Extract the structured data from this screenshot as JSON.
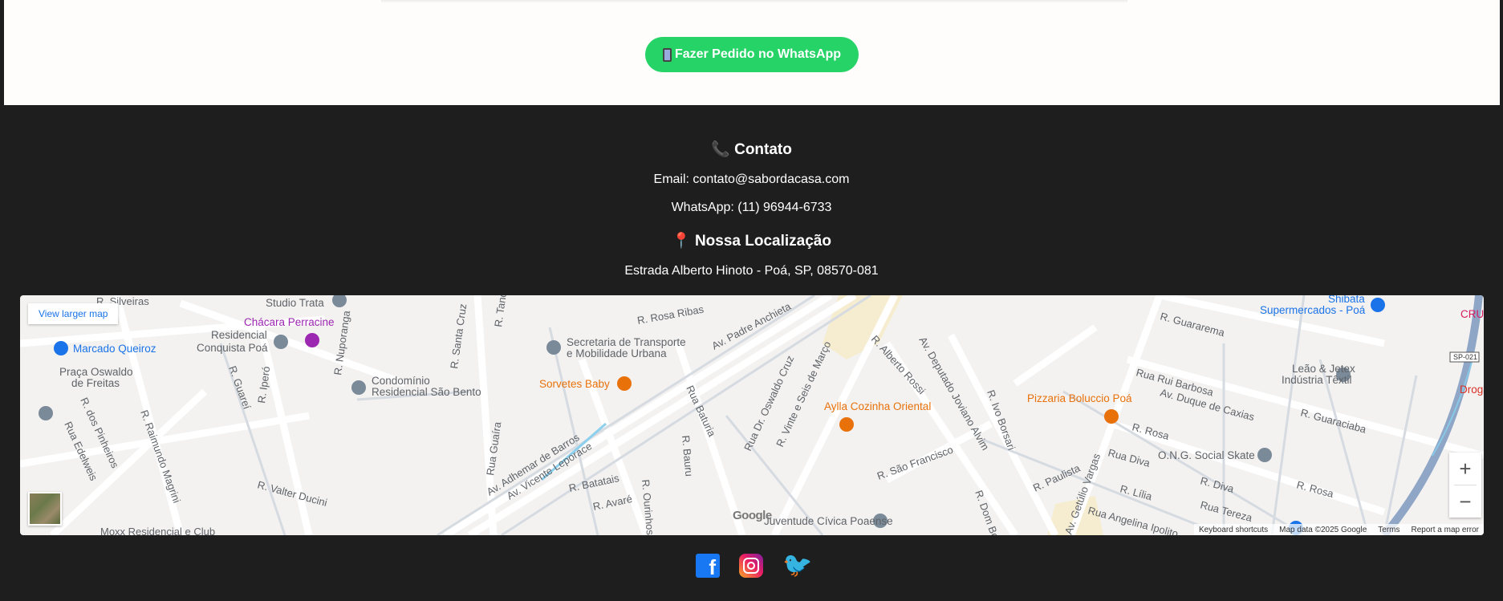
{
  "cta": {
    "whatsapp_button": "Fazer Pedido no WhatsApp"
  },
  "contact": {
    "title": "Contato",
    "email": "Email: contato@sabordacasa.com",
    "whatsapp": "WhatsApp: (11) 96944-6733"
  },
  "location": {
    "title": "Nossa Localização",
    "address": "Estrada Alberto Hinoto - Poá, SP, 08570-081"
  },
  "map": {
    "view_larger": "View larger map",
    "zoom_in": "+",
    "zoom_out": "−",
    "google": "Google",
    "attribution": {
      "shortcuts": "Keyboard shortcuts",
      "data": "Map data ©2025 Google",
      "terms": "Terms",
      "report": "Report a map error"
    },
    "places": {
      "studio_trata": "Studio Trata",
      "chacara": "Chácara Perracine",
      "residencial1": "Residencial",
      "residencial2": "Conquista Poá",
      "marcado": "Marcado Queiroz",
      "praca1": "Praça Oswaldo",
      "praca2": "de Freitas",
      "condominio1": "Condomínio",
      "condominio2": "Residencial São Bento",
      "secretaria1": "Secretaria de Transporte",
      "secretaria2": "e Mobilidade Urbana",
      "sorvetes": "Sorvetes Baby",
      "aylla": "Aylla Cozinha Oriental",
      "pizzaria": "Pizzaria Boluccio Poá",
      "shibata1": "Shibata",
      "shibata2": "Supermercados - Poá",
      "leao1": "Leão & Jetex",
      "leao2": "Indústria Têxtil",
      "ong": "O.N.G. Social Skate",
      "juventude": "Juventude Cívica Poaense",
      "drogaria": "Drogaria",
      "cru": "CRU",
      "sp021": "SP-021"
    },
    "streets": {
      "silveiras": "R. Silveiras",
      "rosa_ribas": "R. Rosa Ribas",
      "padre_anchieta": "Av. Padre Anchieta",
      "alberto_rossi": "R. Alberto Rossi",
      "deputado": "Av. Deputado Joviano Alvim",
      "ivo_borsari": "R. Ivo Borsari",
      "guararema": "R. Guararema",
      "rui_barbosa": "Rua Rui Barbosa",
      "duque": "Av. Duque de Caxias",
      "guaraciaba": "R. Guaraciaba",
      "rosa1": "R. Rosa",
      "rua_diva": "Rua Diva",
      "r_diva": "R. Diva",
      "r_rosa2": "R. Rosa",
      "tereza": "Rua Tereza",
      "lilia": "R. Lília",
      "angelina": "Rua Angelina Ipolito",
      "getulio": "Av. Getúlio Vargas",
      "paulista": "R. Paulista",
      "dom_bosco": "R. Dom Bosco",
      "sao_francisco": "R. São Francisco",
      "vinte_seis": "R. Vinte e Seis de Março",
      "oswaldo_cruz": "Rua Dr. Oswaldo Cruz",
      "baturia": "Rua Baturia",
      "bauru": "R. Bauru",
      "ourinhos": "R. Ourinhos",
      "batatais": "R. Batatais",
      "avare": "R. Avaré",
      "adhemar": "Av. Adhemar de Barros",
      "vicente": "Av. Vicente Leporace",
      "guaira": "Rua Guaíra",
      "santa_cruz": "R. Santa Cruz",
      "nuporanga": "R. Nuporanga",
      "ipero": "R. Iperó",
      "guarei": "R. Guareí",
      "raimundo": "R. Raimundo Magrini",
      "pinheiros": "R. dos Pinheiros",
      "edelweis": "Rua Edelweis",
      "valter": "R. Valter Ducini",
      "moxx": "Moxx Residencial e Club",
      "tanq": "R. Tanq"
    }
  },
  "social": [
    "facebook",
    "instagram",
    "twitter"
  ],
  "colors": {
    "whatsapp": "#25d366",
    "footer_bg": "#1e1e1e",
    "top_bg": "#fefdfb"
  }
}
